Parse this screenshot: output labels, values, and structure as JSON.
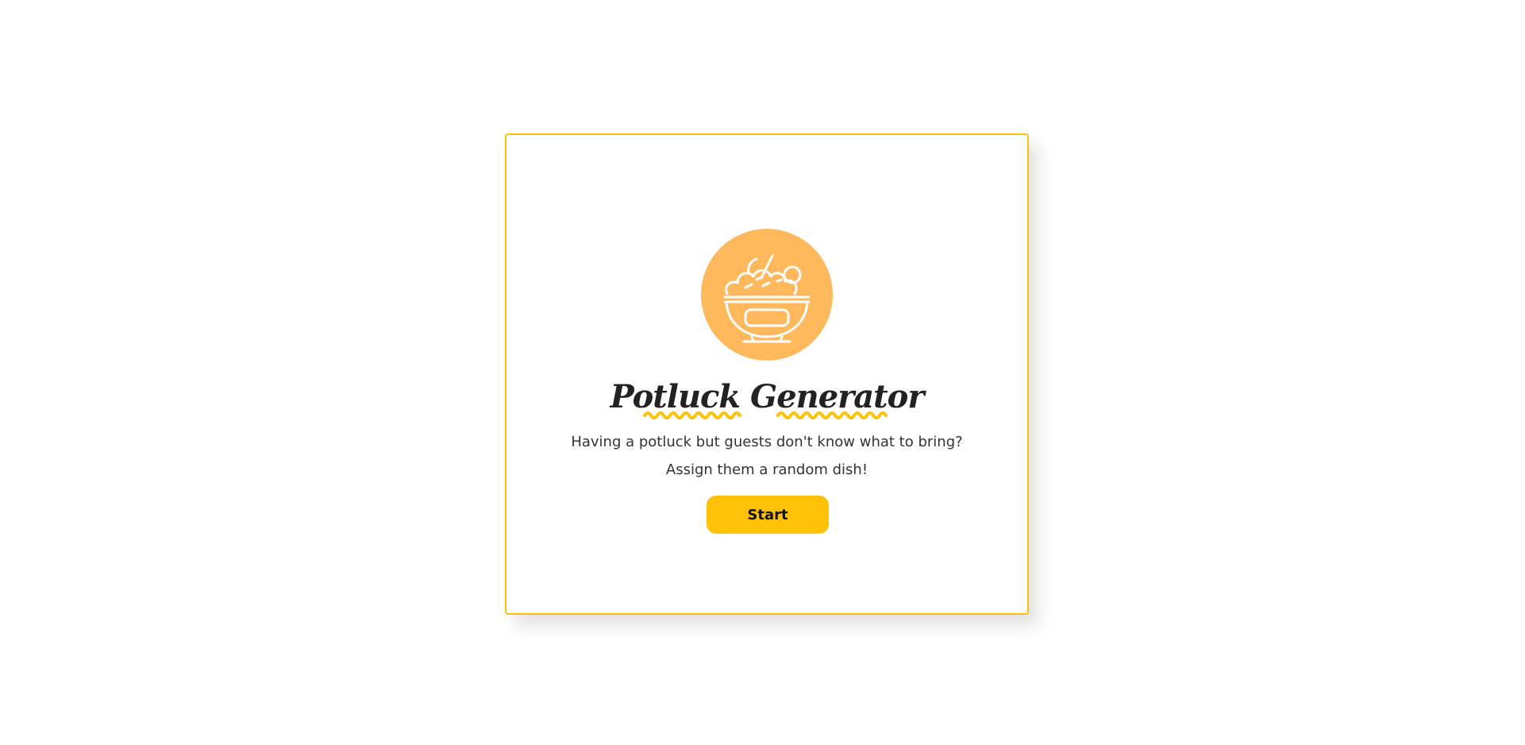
{
  "app": {
    "title": "Potluck Generator",
    "icon": "salad-bowl-icon"
  },
  "intro": {
    "line1": "Having a potluck but guests don't know what to bring?",
    "line2": "Assign them a random dish!"
  },
  "actions": {
    "start_label": "Start"
  },
  "colors": {
    "accent": "#ffc107",
    "circle": "#ffb95c",
    "text": "#222222"
  }
}
